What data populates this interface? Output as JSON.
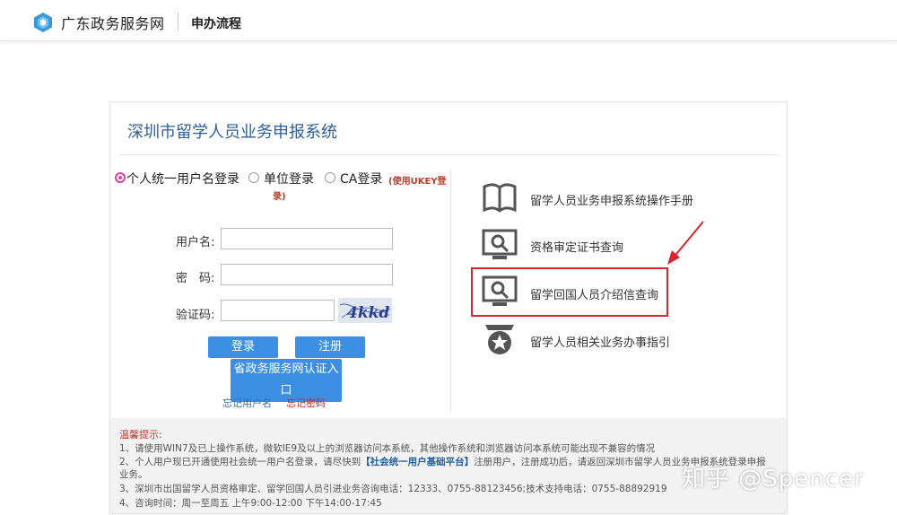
{
  "header": {
    "site_name": "广东政务服务网",
    "nav_link": "申办流程"
  },
  "system": {
    "title": "深圳市留学人员业务申报系统"
  },
  "login": {
    "options": [
      {
        "label": "个人统一用户名登录",
        "selected": true
      },
      {
        "label": "单位登录",
        "selected": false
      },
      {
        "label": "CA登录",
        "selected": false
      }
    ],
    "ca_note_line1": "(使用UKEY登",
    "ca_note_line2": "录)",
    "username_label": "用户名:",
    "password_label": "密　码:",
    "captcha_label": "验证码:",
    "captcha_text": "4kkd",
    "login_button": "登录",
    "register_button": "注册",
    "gov_auth_button": "省政务服务网认证入口",
    "forgot_username": "忘记用户名",
    "forgot_password": "忘记密码"
  },
  "quick_links": [
    {
      "label": "留学人员业务申报系统操作手册",
      "icon": "book-icon"
    },
    {
      "label": "资格审定证书查询",
      "icon": "monitor-search-icon"
    },
    {
      "label": "留学回国人员介绍信查询",
      "icon": "monitor-search-icon"
    },
    {
      "label": "留学人员相关业务办事指引",
      "icon": "medal-icon"
    }
  ],
  "tips": {
    "title": "温馨提示:",
    "line1": "1、请使用WIN7及已上操作系统，微软IE9及以上的浏览器访问本系统，其他操作系统和浏览器访问本系统可能出现不兼容的情况",
    "line2_a": "2、个人用户现已开通使用社会统一用户名登录，请尽快到",
    "line2_link": "【社会统一用户基础平台】",
    "line2_b": "注册用户，注册成功后，请返回深圳市留学人员业务申报系统登录申报",
    "line2_cont": "业务。",
    "line3": "3、深圳市出国留学人员资格审定、留学回国人员引进业务咨询电话：12333、0755-88123456;技术支持电话：0755-88892919",
    "line4": "4、咨询时间：周一至周五 上午9:00-12:00 下午14:00-17:45"
  },
  "watermark": "知乎 @Spencer",
  "colors": {
    "accent_blue": "#3d8fe6",
    "title_blue": "#2f5f99",
    "highlight_red": "#d9262c",
    "radio_pink": "#e0409a"
  }
}
